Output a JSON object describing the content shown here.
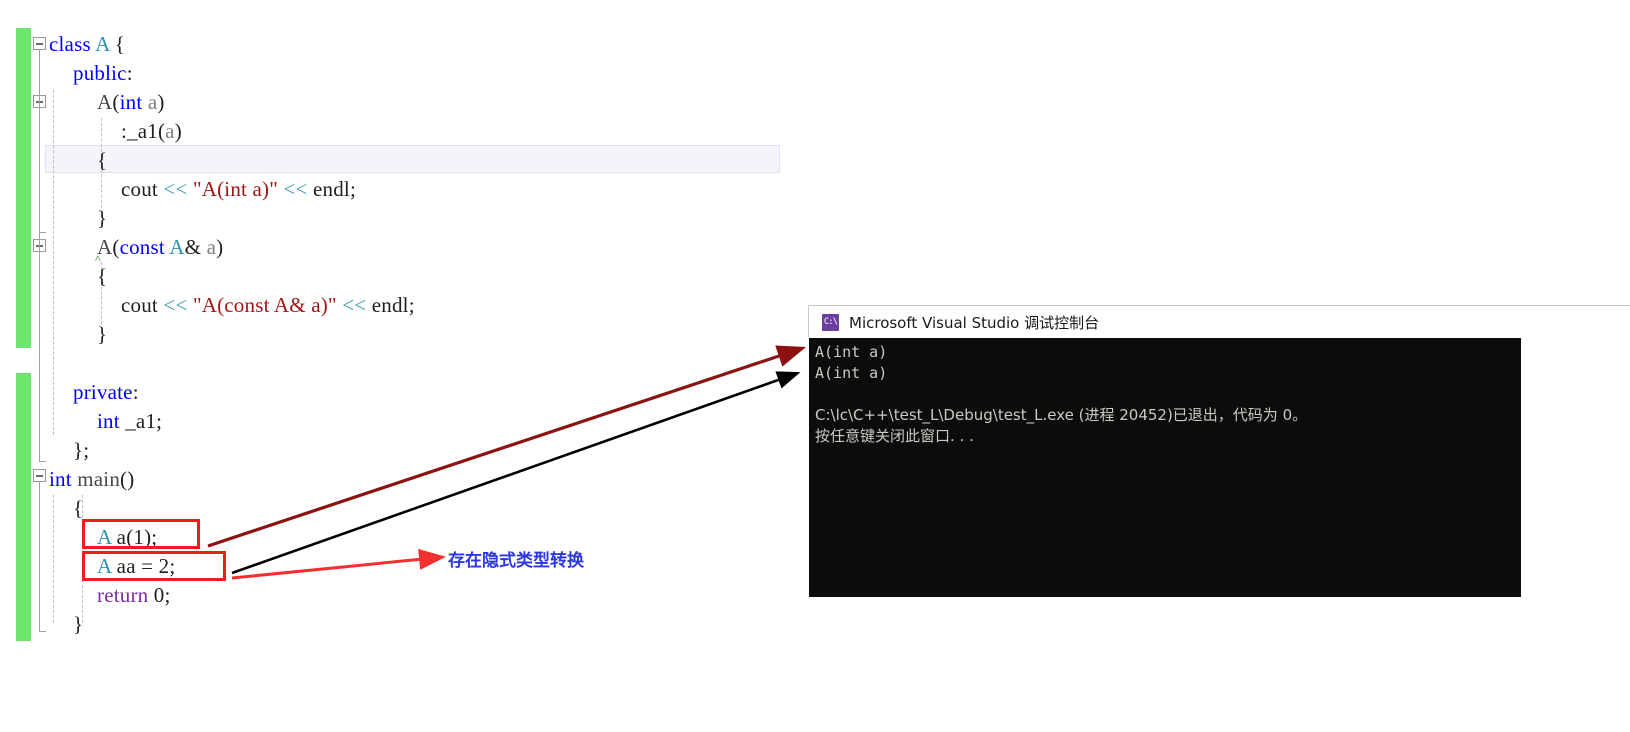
{
  "editor": {
    "name": "visual-studio-code-editor",
    "lines": [
      {
        "indent": 0,
        "tokens": [
          {
            "t": "class",
            "c": "kw"
          },
          {
            "t": " ",
            "c": "plain"
          },
          {
            "t": "A",
            "c": "type"
          },
          {
            "t": " {",
            "c": "plain"
          }
        ]
      },
      {
        "indent": 1,
        "tokens": [
          {
            "t": "public",
            "c": "kw"
          },
          {
            "t": ":",
            "c": "plain"
          }
        ]
      },
      {
        "indent": 2,
        "tokens": [
          {
            "t": "A",
            "c": "func"
          },
          {
            "t": "(",
            "c": "plain"
          },
          {
            "t": "int",
            "c": "kw"
          },
          {
            "t": " ",
            "c": "plain"
          },
          {
            "t": "a",
            "c": "param"
          },
          {
            "t": ")",
            "c": "plain"
          }
        ]
      },
      {
        "indent": 3,
        "tokens": [
          {
            "t": ":_a1(",
            "c": "plain"
          },
          {
            "t": "a",
            "c": "param"
          },
          {
            "t": ")",
            "c": "plain"
          }
        ]
      },
      {
        "indent": 2,
        "tokens": [
          {
            "t": "{",
            "c": "plain"
          }
        ]
      },
      {
        "indent": 3,
        "tokens": [
          {
            "t": "cout ",
            "c": "plain"
          },
          {
            "t": "<<",
            "c": "op"
          },
          {
            "t": " ",
            "c": "plain"
          },
          {
            "t": "\"A(int a)\"",
            "c": "str"
          },
          {
            "t": " ",
            "c": "plain"
          },
          {
            "t": "<<",
            "c": "op"
          },
          {
            "t": " endl;",
            "c": "plain"
          }
        ]
      },
      {
        "indent": 2,
        "tokens": [
          {
            "t": "}",
            "c": "plain"
          }
        ]
      },
      {
        "indent": 2,
        "tokens": [
          {
            "t": "A",
            "c": "func"
          },
          {
            "t": "(",
            "c": "plain"
          },
          {
            "t": "const",
            "c": "kw"
          },
          {
            "t": " ",
            "c": "plain"
          },
          {
            "t": "A",
            "c": "type"
          },
          {
            "t": "& ",
            "c": "plain"
          },
          {
            "t": "a",
            "c": "param"
          },
          {
            "t": ")",
            "c": "plain"
          }
        ]
      },
      {
        "indent": 2,
        "tokens": [
          {
            "t": "{",
            "c": "plain"
          }
        ]
      },
      {
        "indent": 3,
        "tokens": [
          {
            "t": "cout ",
            "c": "plain"
          },
          {
            "t": "<<",
            "c": "op"
          },
          {
            "t": " ",
            "c": "plain"
          },
          {
            "t": "\"A(const A& a)\"",
            "c": "str"
          },
          {
            "t": " ",
            "c": "plain"
          },
          {
            "t": "<<",
            "c": "op"
          },
          {
            "t": " endl;",
            "c": "plain"
          }
        ]
      },
      {
        "indent": 2,
        "tokens": [
          {
            "t": "}",
            "c": "plain"
          }
        ]
      },
      {
        "indent": 0,
        "tokens": []
      },
      {
        "indent": 1,
        "tokens": [
          {
            "t": "private",
            "c": "kw"
          },
          {
            "t": ":",
            "c": "plain"
          }
        ]
      },
      {
        "indent": 2,
        "tokens": [
          {
            "t": "int",
            "c": "kw"
          },
          {
            "t": " _a1;",
            "c": "plain"
          }
        ]
      },
      {
        "indent": 1,
        "tokens": [
          {
            "t": "};",
            "c": "plain"
          }
        ]
      },
      {
        "indent": 0,
        "tokens": [
          {
            "t": "int",
            "c": "kw"
          },
          {
            "t": " ",
            "c": "plain"
          },
          {
            "t": "main",
            "c": "func"
          },
          {
            "t": "()",
            "c": "plain"
          }
        ]
      },
      {
        "indent": 1,
        "tokens": [
          {
            "t": "{",
            "c": "plain"
          }
        ]
      },
      {
        "indent": 2,
        "tokens": [
          {
            "t": "A",
            "c": "type"
          },
          {
            "t": " a(1);",
            "c": "plain"
          }
        ]
      },
      {
        "indent": 2,
        "tokens": [
          {
            "t": "A",
            "c": "type"
          },
          {
            "t": " aa = 2;",
            "c": "plain"
          }
        ]
      },
      {
        "indent": 2,
        "tokens": [
          {
            "t": "return",
            "c": "purple"
          },
          {
            "t": " 0;",
            "c": "plain"
          }
        ]
      },
      {
        "indent": 1,
        "tokens": [
          {
            "t": "}",
            "c": "plain"
          }
        ]
      }
    ],
    "fold_markers": [
      {
        "line": 0,
        "state": "collapsible-expanded"
      },
      {
        "line": 2,
        "state": "collapsible-expanded"
      },
      {
        "line": 7,
        "state": "collapsible-expanded"
      },
      {
        "line": 15,
        "state": "collapsible-expanded"
      }
    ],
    "current_line_index": 4
  },
  "annotations": {
    "highlight_boxes": [
      {
        "label": "A a(1);",
        "color": "#f21a1a"
      },
      {
        "label": "A aa = 2;",
        "color": "#f21a1a"
      }
    ],
    "callout_text": "存在隐式类型转换",
    "callout_color": "#2b37e0",
    "arrows": [
      {
        "name": "arrow-a-a1-to-output",
        "color": "#8c1111"
      },
      {
        "name": "arrow-a-aa-to-output",
        "color": "#000000"
      },
      {
        "name": "arrow-callout",
        "color": "#f2312f"
      }
    ]
  },
  "console": {
    "title": "Microsoft Visual Studio 调试控制台",
    "icon": "console-app-icon",
    "icon_glyph": "C:\\",
    "lines": [
      "A(int a)",
      "A(int a)",
      "",
      "C:\\lc\\C++\\test_L\\Debug\\test_L.exe (进程 20452)已退出，代码为 0。",
      "按任意键关闭此窗口. . ."
    ],
    "background": "#0c0c0c",
    "text_color": "#ccc9c1"
  },
  "background_fragments": {
    "frag1": "}",
    "frag2": "l("
  }
}
